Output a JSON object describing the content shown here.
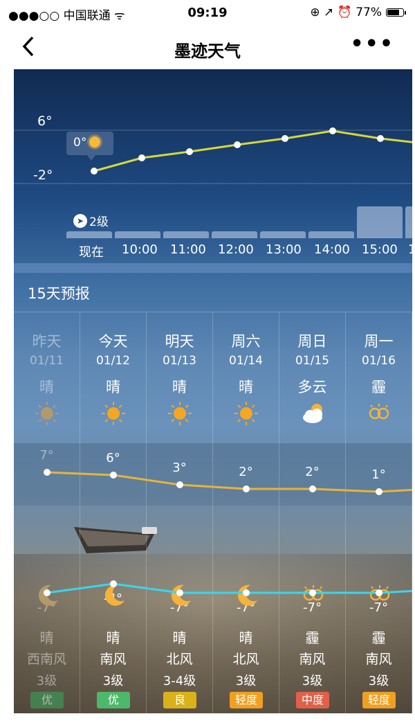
{
  "status_bar": {
    "carrier": "●●●○○ 中国联通 ᯤ",
    "time": "09:19",
    "indicators": "⊕ ↗ ⏰ 77%"
  },
  "nav": {
    "back_icon": "chevron-left-icon",
    "back_glyph": "〈",
    "title": "墨迹天气",
    "more_glyph": "•••"
  },
  "hourly": {
    "y_labels": [
      "6°",
      "-2°"
    ],
    "current_badge": "0°",
    "wind_label": "2级",
    "times": [
      "现在",
      "10:00",
      "11:00",
      "12:00",
      "13:00",
      "14:00",
      "15:00",
      "1"
    ],
    "line_color": "#d7d83a"
  },
  "forecast": {
    "title": "15天预报",
    "days": [
      {
        "name": "昨天",
        "date": "01/11",
        "cond": "晴",
        "icon": "sun-icon",
        "high": "7°",
        "low": "-7°",
        "night_icon": "moon-icon",
        "night_cond": "晴",
        "wind_dir": "西南风",
        "wind_lvl": "3级",
        "aqi": "优",
        "aqi_color": "#3aa35a",
        "past": true
      },
      {
        "name": "今天",
        "date": "01/12",
        "cond": "晴",
        "icon": "sun-icon",
        "high": "6°",
        "low": "-4°",
        "night_icon": "moon-icon",
        "night_cond": "晴",
        "wind_dir": "南风",
        "wind_lvl": "3级",
        "aqi": "优",
        "aqi_color": "#4cb96a",
        "past": false
      },
      {
        "name": "明天",
        "date": "01/13",
        "cond": "晴",
        "icon": "sun-icon",
        "high": "3°",
        "low": "-7°",
        "night_icon": "moon-icon",
        "night_cond": "晴",
        "wind_dir": "北风",
        "wind_lvl": "3-4级",
        "aqi": "良",
        "aqi_color": "#d9b21a",
        "past": false
      },
      {
        "name": "周六",
        "date": "01/14",
        "cond": "晴",
        "icon": "sun-icon",
        "high": "2°",
        "low": "-7°",
        "night_icon": "moon-icon",
        "night_cond": "晴",
        "wind_dir": "北风",
        "wind_lvl": "3级",
        "aqi": "轻度",
        "aqi_color": "#f0a020",
        "past": false
      },
      {
        "name": "周日",
        "date": "01/15",
        "cond": "多云",
        "icon": "cloud-sun-icon",
        "high": "2°",
        "low": "-7°",
        "night_icon": "haze-icon",
        "night_cond": "霾",
        "wind_dir": "南风",
        "wind_lvl": "3级",
        "aqi": "中度",
        "aqi_color": "#e0604a",
        "past": false
      },
      {
        "name": "周一",
        "date": "01/16",
        "cond": "霾",
        "icon": "haze-icon",
        "high": "1°",
        "low": "-7°",
        "night_icon": "haze-icon",
        "night_cond": "霾",
        "wind_dir": "南风",
        "wind_lvl": "3级",
        "aqi": "轻度",
        "aqi_color": "#f0a020",
        "past": false
      }
    ],
    "high_line_color": "#e8b33a",
    "low_line_color": "#38d6f0"
  }
}
